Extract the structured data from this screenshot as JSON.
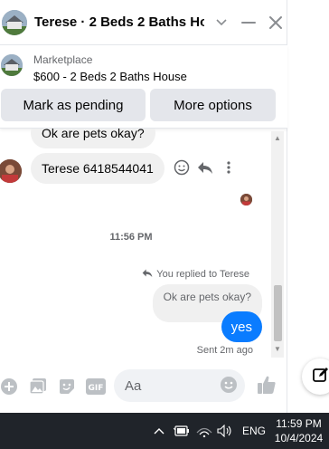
{
  "header": {
    "title": "Terese · 2 Beds 2 Baths Ho...",
    "avatar_icon": "house-icon",
    "chevron_icon": "chevron-down-icon",
    "minimize_icon": "minimize-icon",
    "close_icon": "close-icon"
  },
  "marketplace": {
    "label": "Marketplace",
    "listing": "$600 - 2 Beds 2 Baths House",
    "pending_button": "Mark as pending",
    "options_button": "More options"
  },
  "messages": {
    "incoming_1": "Ok are pets okay?",
    "incoming_2": "Terese 6418544041",
    "timestamp": "11:56 PM",
    "replied_label": "You replied to Terese",
    "quoted": "Ok are pets okay?",
    "outgoing": "yes",
    "sent_status": "Sent 2m ago"
  },
  "composer": {
    "placeholder": "Aa",
    "gif_label": "GIF"
  },
  "taskbar": {
    "language": "ENG",
    "time": "11:59 PM",
    "date": "10/4/2024"
  },
  "colors": {
    "accent": "#0a7cff",
    "taskbar": "#20242a"
  }
}
